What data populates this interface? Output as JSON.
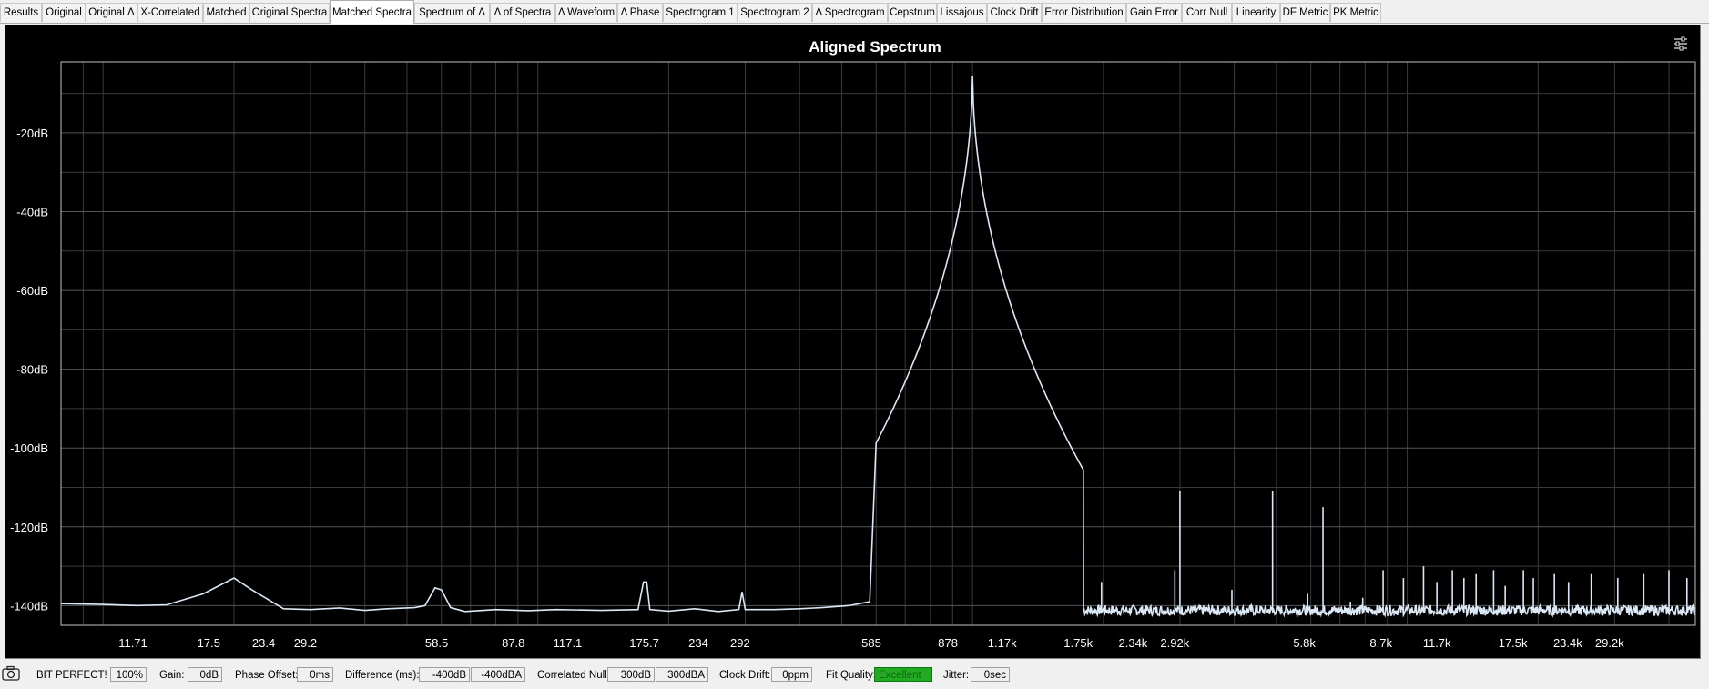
{
  "tabs": [
    {
      "label": "Results",
      "left": 0,
      "w": 46
    },
    {
      "label": "Original",
      "left": 46,
      "w": 48
    },
    {
      "label": "Original Δ",
      "left": 94,
      "w": 57
    },
    {
      "label": "X-Correlated",
      "left": 151,
      "w": 72
    },
    {
      "label": "Matched",
      "left": 223,
      "w": 51
    },
    {
      "label": "Original Spectra",
      "left": 274,
      "w": 88
    },
    {
      "label": "Matched Spectra",
      "left": 362,
      "w": 93
    },
    {
      "label": "Spectrum of Δ",
      "left": 455,
      "w": 83
    },
    {
      "label": "Δ of Spectra",
      "left": 538,
      "w": 72
    },
    {
      "label": "Δ Waveform",
      "left": 610,
      "w": 68
    },
    {
      "label": "Δ Phase",
      "left": 678,
      "w": 50
    },
    {
      "label": "Spectrogram 1",
      "left": 728,
      "w": 82
    },
    {
      "label": "Spectrogram 2",
      "left": 810,
      "w": 82
    },
    {
      "label": "Δ Spectrogram",
      "left": 892,
      "w": 83
    },
    {
      "label": "Cepstrum",
      "left": 975,
      "w": 54
    },
    {
      "label": "Lissajous",
      "left": 1029,
      "w": 55
    },
    {
      "label": "Clock Drift",
      "left": 1084,
      "w": 60
    },
    {
      "label": "Error Distribution",
      "left": 1144,
      "w": 93
    },
    {
      "label": "Gain Error",
      "left": 1237,
      "w": 61
    },
    {
      "label": "Corr Null",
      "left": 1298,
      "w": 55
    },
    {
      "label": "Linearity",
      "left": 1353,
      "w": 53
    },
    {
      "label": "DF Metric",
      "left": 1406,
      "w": 55
    },
    {
      "label": "PK Metric",
      "left": 1461,
      "w": 56
    }
  ],
  "active_tab": 6,
  "chart_data": {
    "type": "line",
    "title": "Aligned Spectrum",
    "xlabel": "",
    "ylabel": "",
    "x_scale": "log",
    "xlim": [
      8,
      46000
    ],
    "ylim": [
      -145,
      -2
    ],
    "x_ticks": [
      "11.71",
      "17.5",
      "23.4",
      "29.2",
      "58.5",
      "87.8",
      "117.1",
      "175.7",
      "234",
      "292",
      "585",
      "878",
      "1.17k",
      "1.75k",
      "2.34k",
      "2.92k",
      "5.8k",
      "8.7k",
      "11.7k",
      "17.5k",
      "23.4k",
      "29.2k"
    ],
    "x_tick_values": [
      11.71,
      17.5,
      23.4,
      29.2,
      58.5,
      87.8,
      117.1,
      175.7,
      234,
      292,
      585,
      878,
      1170,
      1750,
      2340,
      2920,
      5800,
      8700,
      11700,
      17500,
      23400,
      29200
    ],
    "y_ticks": [
      "-20dB",
      "-40dB",
      "-60dB",
      "-80dB",
      "-100dB",
      "-120dB",
      "-140dB"
    ],
    "y_tick_values": [
      -20,
      -40,
      -60,
      -80,
      -100,
      -120,
      -140
    ],
    "grid": true,
    "line_color": "#dbe8f5",
    "series": [
      {
        "low_freq_points": [
          [
            8,
            -139.5
          ],
          [
            10,
            -139.7
          ],
          [
            12,
            -140
          ],
          [
            14,
            -139.8
          ],
          [
            17,
            -137
          ],
          [
            20,
            -133
          ],
          [
            22,
            -136
          ],
          [
            26,
            -140.8
          ],
          [
            30,
            -141
          ],
          [
            35,
            -140.6
          ],
          [
            40,
            -141.2
          ],
          [
            45,
            -140.8
          ],
          [
            52,
            -140.5
          ],
          [
            55,
            -140
          ],
          [
            58,
            -135.5
          ],
          [
            60,
            -136
          ],
          [
            63,
            -140.5
          ],
          [
            68,
            -141.5
          ],
          [
            80,
            -141
          ],
          [
            95,
            -141.3
          ],
          [
            110,
            -141
          ],
          [
            140,
            -141.2
          ],
          [
            170,
            -141
          ],
          [
            175,
            -134
          ],
          [
            178,
            -134
          ],
          [
            181,
            -141
          ],
          [
            200,
            -141.4
          ],
          [
            230,
            -140.8
          ],
          [
            260,
            -141.5
          ],
          [
            290,
            -141
          ],
          [
            295,
            -136.5
          ],
          [
            300,
            -141
          ],
          [
            350,
            -141
          ],
          [
            400,
            -140.8
          ],
          [
            450,
            -140.5
          ],
          [
            520,
            -140
          ],
          [
            580,
            -139
          ]
        ],
        "peak": {
          "freq": 1000,
          "db": -4
        },
        "spurs": [
          [
            1980,
            -134
          ],
          [
            2920,
            -131
          ],
          [
            3000,
            -111
          ],
          [
            3950,
            -136
          ],
          [
            4900,
            -111
          ],
          [
            5900,
            -137
          ],
          [
            6400,
            -115
          ],
          [
            7400,
            -139
          ],
          [
            7900,
            -138
          ],
          [
            8800,
            -131
          ],
          [
            9800,
            -133
          ],
          [
            10900,
            -130
          ],
          [
            11700,
            -134
          ],
          [
            12700,
            -131
          ],
          [
            13500,
            -133
          ],
          [
            14400,
            -132
          ],
          [
            15800,
            -131
          ],
          [
            16800,
            -135
          ],
          [
            18500,
            -131
          ],
          [
            19500,
            -133
          ],
          [
            21800,
            -132
          ],
          [
            23500,
            -134
          ],
          [
            26500,
            -132
          ],
          [
            30500,
            -133
          ],
          [
            35000,
            -132
          ],
          [
            40000,
            -131
          ],
          [
            44000,
            -133
          ]
        ]
      }
    ]
  },
  "status": {
    "bit_perfect": "BIT PERFECT!",
    "bit_perfect_pct": "100%",
    "gain_label": "Gain:",
    "gain_value": "0dB",
    "phase_label": "Phase Offset:",
    "phase_value": "0ms",
    "diff_label": "Difference (ms):",
    "diff_db": "-400dB",
    "diff_dba": "-400dBA",
    "corr_label": "Correlated Null:",
    "corr_db": "300dB",
    "corr_dba": "300dBA",
    "drift_label": "Clock Drift:",
    "drift_value": "0ppm",
    "fit_label": "Fit Quality:",
    "fit_value": "Excellent",
    "jitter_label": "Jitter:",
    "jitter_value": "0sec"
  },
  "colors": {
    "plot_bg": "#000000",
    "grid": "#3a3a3a",
    "axis_text": "#ffffff",
    "fit_good": "#22aa22"
  },
  "icons": {
    "settings": "sliders-icon",
    "camera": "camera-icon"
  }
}
